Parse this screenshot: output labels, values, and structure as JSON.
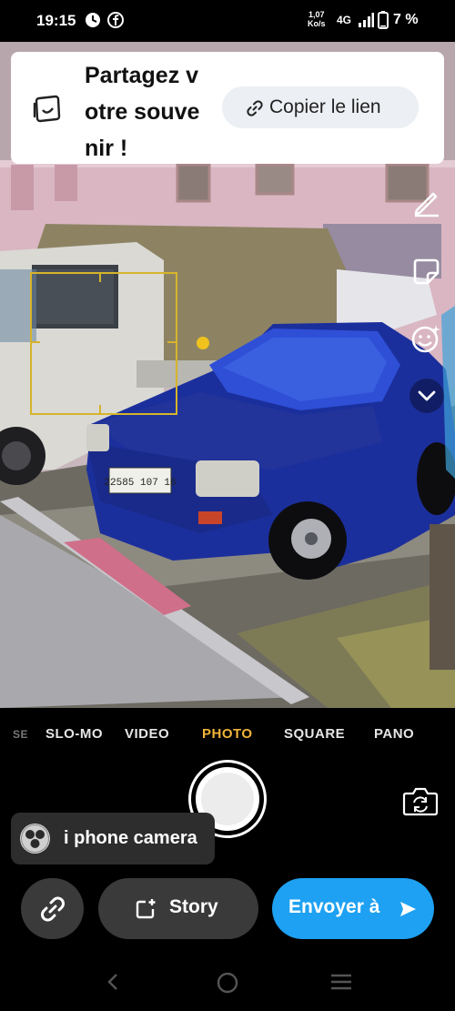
{
  "status_bar": {
    "time": "19:15",
    "net_speed_value": "1,07",
    "net_speed_unit": "Ko/s",
    "network": "4G",
    "battery": "7 %"
  },
  "share_card": {
    "title": "Partagez votre souvenir !",
    "copy_link_label": "Copier le lien"
  },
  "camera": {
    "modes": [
      "SE",
      "SLO-MO",
      "VIDEO",
      "PHOTO",
      "SQUARE",
      "PANO"
    ],
    "active_mode": "PHOTO",
    "license_plate": "22585 107 16"
  },
  "caption": {
    "text": "i phone camera"
  },
  "actions": {
    "story_label": "Story",
    "send_label": "Envoyer à"
  },
  "colors": {
    "accent": "#1ea1f2",
    "active_mode": "#f0b43a",
    "focus_box": "#d6b42a"
  },
  "icons": {
    "status": [
      "clock-app-icon",
      "facebook-icon",
      "signal-icon",
      "battery-icon"
    ],
    "side_tools": [
      "pencil-icon",
      "sticker-icon",
      "smiley-icon",
      "chevron-down-icon"
    ],
    "share": [
      "memories-icon",
      "link-icon"
    ],
    "camera": [
      "flip-camera-icon"
    ]
  }
}
